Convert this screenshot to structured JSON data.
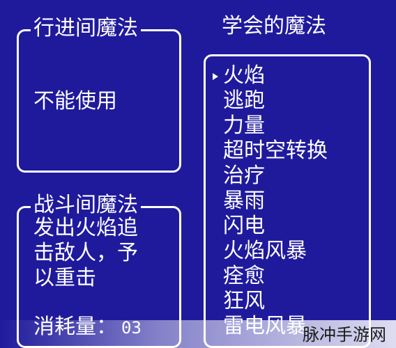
{
  "field_magic": {
    "title": "行进间魔法",
    "status": "不能使用"
  },
  "learned_magic": {
    "title": "学会的魔法",
    "cursor_icon": "triangle-pointer",
    "selected_index": 0,
    "spells": [
      "火焰",
      "逃跑",
      "力量",
      "超时空转换",
      "治疗",
      "暴雨",
      "闪电",
      "火焰风暴",
      "痊愈",
      "狂风",
      "雷电风暴"
    ]
  },
  "battle_magic": {
    "title": "战斗间魔法",
    "description_lines": [
      "发出火焰追",
      "击敌人，予",
      "以重击"
    ],
    "cost_label": "消耗量：",
    "cost_value": "03"
  },
  "watermark": {
    "text": "脉冲手游网"
  },
  "colors": {
    "background": "#1f1a9c",
    "foreground": "#ffffff"
  }
}
